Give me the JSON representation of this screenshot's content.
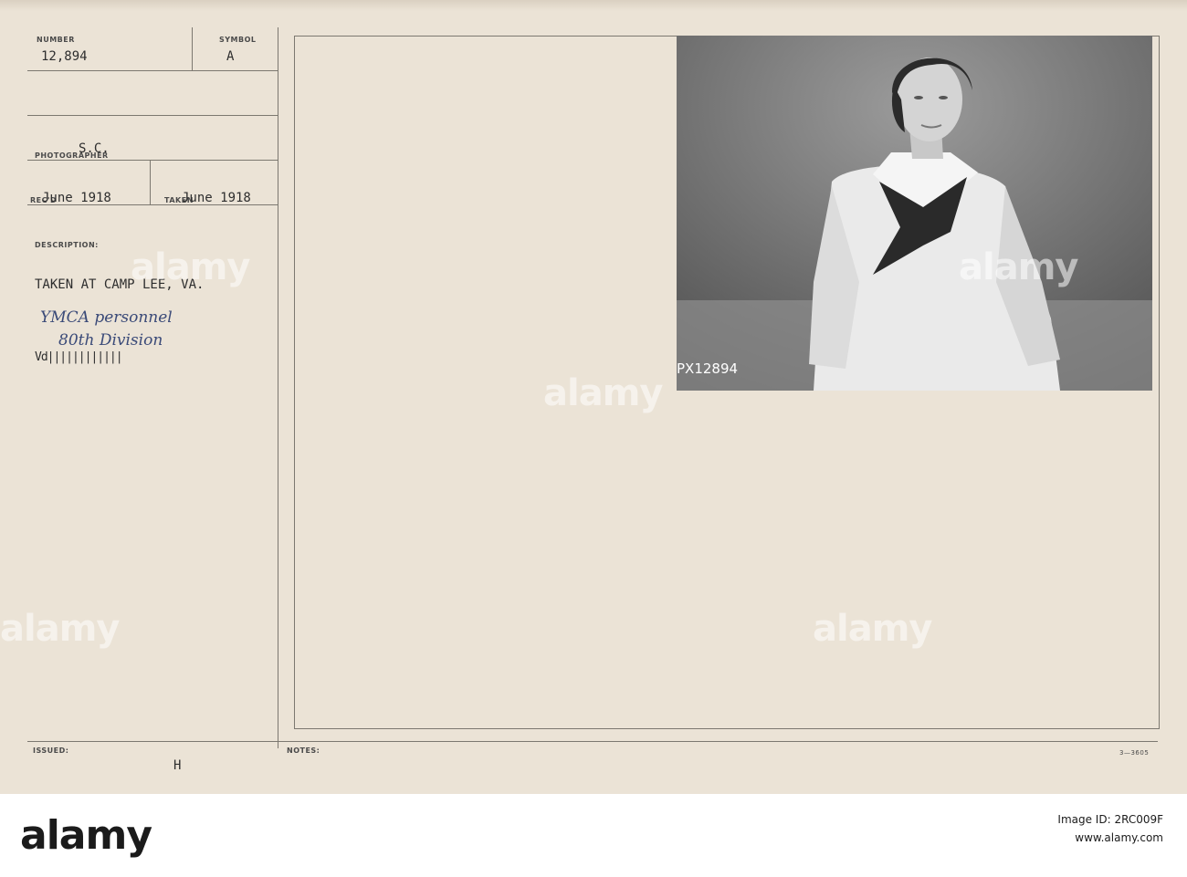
{
  "card": {
    "number_label": "NUMBER",
    "number_value": "12,894",
    "symbol_label": "SYMBOL",
    "symbol_value": "A",
    "photographer_label": "PHOTOGRAPHER",
    "photographer_value": "S.C.",
    "recd_label": "REC'D",
    "recd_value": "June 1918",
    "taken_label": "TAKEN",
    "taken_value": "June 1918",
    "description_label": "DESCRIPTION:",
    "description_line1": "TAKEN AT CAMP LEE, VA.",
    "handwritten_line1": "YMCA personnel",
    "handwritten_line2": "80th Division",
    "struck_text": "Vd||||||||||||",
    "issued_label": "ISSUED:",
    "issued_value": "H",
    "notes_label": "NOTES:",
    "form_code": "3—3605"
  },
  "photo": {
    "negative_number": "PX12894"
  },
  "watermark": {
    "text": "alamy"
  },
  "footer": {
    "logo": "alamy",
    "image_id_label": "Image ID: 2RC009F",
    "url": "www.alamy.com"
  },
  "colors": {
    "card_background": "#ebe3d6",
    "ink_handwritten": "#3a4a78",
    "typed_ink": "#2e2e2e"
  }
}
